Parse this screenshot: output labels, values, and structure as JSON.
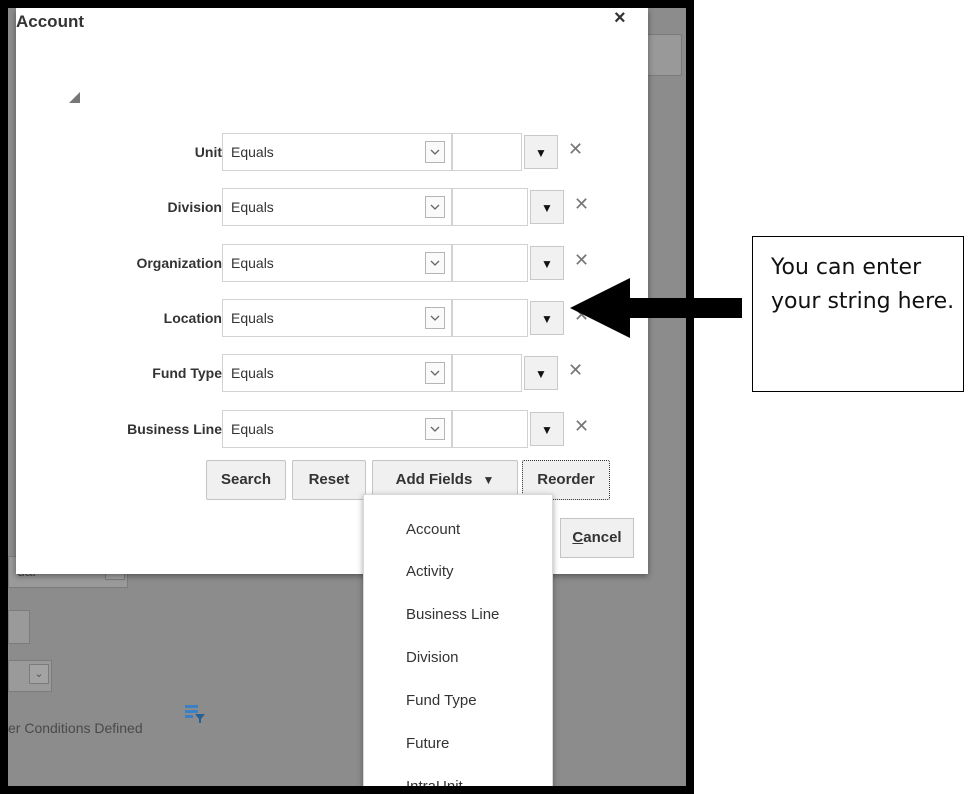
{
  "dialog": {
    "title": "Account",
    "close_glyph": "×"
  },
  "rows": [
    {
      "label": "Unit",
      "operator": "Equals"
    },
    {
      "label": "Division",
      "operator": "Equals"
    },
    {
      "label": "Organization",
      "operator": "Equals"
    },
    {
      "label": "Location",
      "operator": "Equals"
    },
    {
      "label": "Fund Type",
      "operator": "Equals"
    },
    {
      "label": "Business Line",
      "operator": "Equals"
    }
  ],
  "glyphs": {
    "chevron_down": "⌄",
    "dropdown": "▼",
    "delete": "✕"
  },
  "buttons": {
    "search": "Search",
    "reset": "Reset",
    "add_fields": "Add Fields",
    "reorder": "Reorder",
    "cancel_mnemonic": "C",
    "cancel_rest": "ancel"
  },
  "add_fields_menu": [
    "Account",
    "Activity",
    "Business Line",
    "Division",
    "Fund Type",
    "Future",
    "IntraUnit"
  ],
  "background": {
    "button_fragment": "l",
    "select_fragment": "ual",
    "conditions_text": "er Conditions Defined"
  },
  "annotation": {
    "text": "You can enter your string here."
  },
  "colors": {
    "overlay": "#8c8c8c",
    "filter_icon": "#3b7fc4"
  }
}
